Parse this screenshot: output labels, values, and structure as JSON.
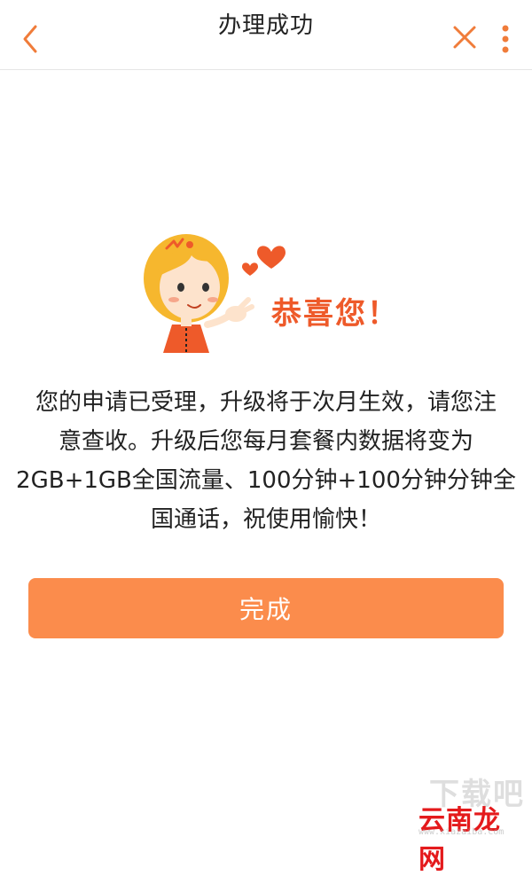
{
  "header": {
    "title": "办理成功",
    "back_icon": "chevron-left-icon",
    "close_icon": "close-icon",
    "more_icon": "more-vertical-icon"
  },
  "main": {
    "congrats_text": "恭喜您！",
    "message_lines": [
      "您的申请已受理，升级将于次月生效，请您注",
      "意查收。升级后您每月套餐内数据将变为",
      "2GB+1GB全国流量、100分钟+100分钟分钟全",
      "国通话，祝使用愉快！"
    ],
    "done_label": "完成"
  },
  "watermark": {
    "top_text": "下载吧",
    "logo_text": "云南龙网",
    "url_text": "www.xiazaiba.com"
  },
  "colors": {
    "accent": "#f07c3a",
    "button": "#fb8c4c",
    "congrats": "#ee5a2a"
  }
}
